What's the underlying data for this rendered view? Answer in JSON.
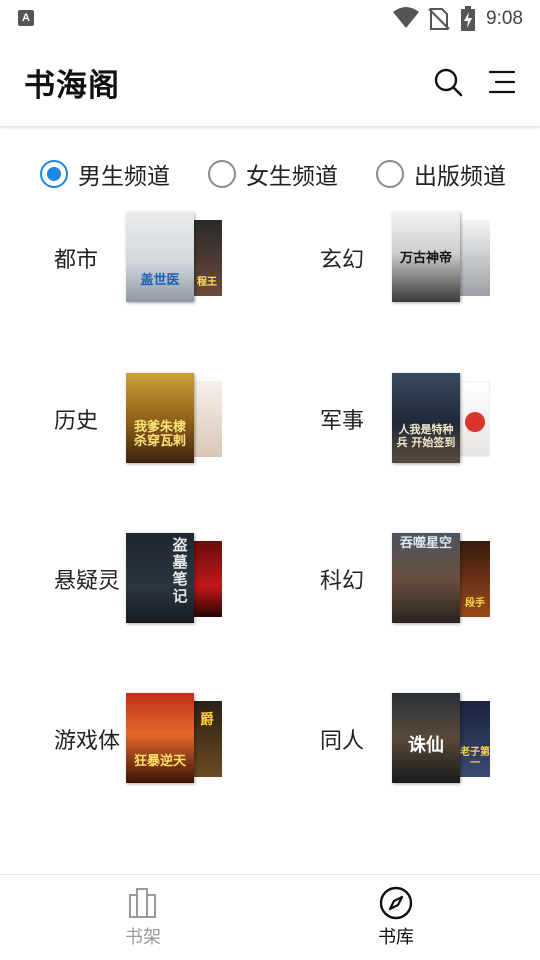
{
  "status_bar": {
    "time": "9:08",
    "app_badge": "A"
  },
  "app_bar": {
    "title": "书海阁"
  },
  "channels": [
    {
      "label": "男生频道",
      "selected": true
    },
    {
      "label": "女生频道",
      "selected": false
    },
    {
      "label": "出版频道",
      "selected": false
    }
  ],
  "categories": [
    {
      "name": "都市",
      "cover_front_title": "盖世医",
      "cover_back_title": "程王"
    },
    {
      "name": "玄幻",
      "cover_front_title": "万古神帝",
      "cover_back_title": ""
    },
    {
      "name": "历史",
      "cover_front_title": "我爹朱棣 杀穿瓦剌",
      "cover_back_title": ""
    },
    {
      "name": "军事",
      "cover_front_title": "人我是特种兵 开始签到",
      "cover_back_title": ""
    },
    {
      "name": "悬疑灵",
      "cover_front_title": "盗墓笔记",
      "cover_back_title": ""
    },
    {
      "name": "科幻",
      "cover_front_title": "吞噬星空",
      "cover_back_title": "段手"
    },
    {
      "name": "游戏体",
      "cover_front_title": "狂暴逆天",
      "cover_back_title": "爵"
    },
    {
      "name": "同人",
      "cover_front_title": "诛仙",
      "cover_back_title": "老子第一"
    }
  ],
  "bottom_nav": [
    {
      "label": "书架",
      "icon": "bookshelf-icon",
      "active": false
    },
    {
      "label": "书库",
      "icon": "compass-icon",
      "active": true
    }
  ],
  "colors": {
    "accent": "#1e88e5",
    "inactive": "#9a9a9a"
  }
}
